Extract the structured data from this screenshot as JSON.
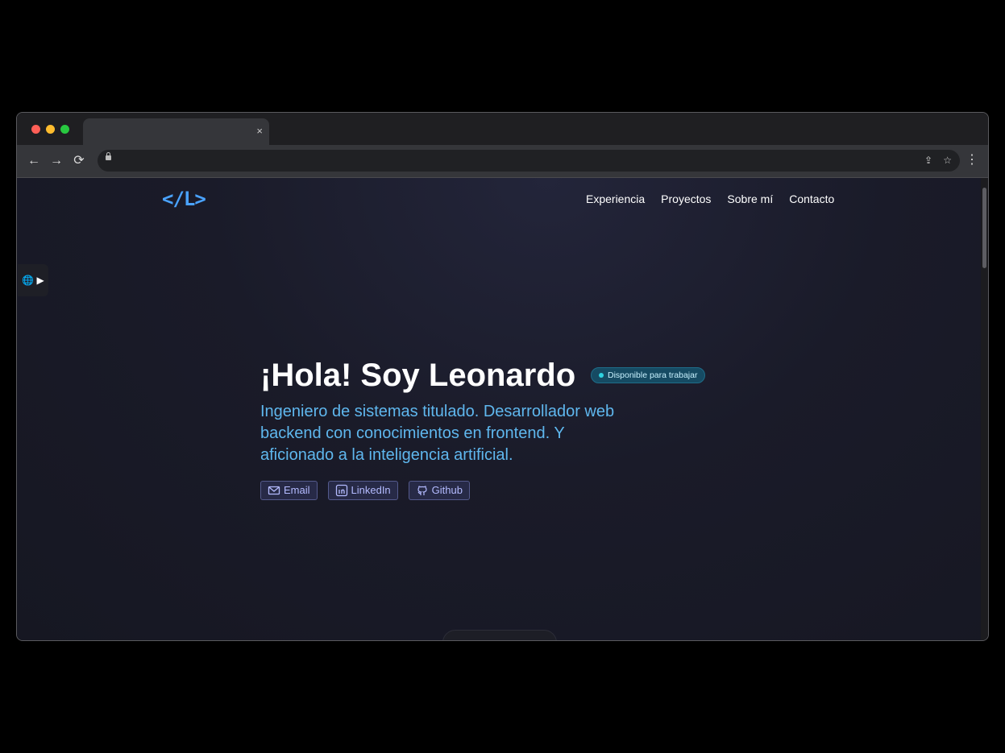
{
  "browser": {
    "tab_close": "×",
    "back_icon": "←",
    "forward_icon": "→",
    "reload_icon": "⟳",
    "share_icon": "⇪",
    "star_icon": "☆",
    "menu_icon": "⋮"
  },
  "site": {
    "logo": "</L>",
    "nav": [
      "Experiencia",
      "Proyectos",
      "Sobre mí",
      "Contacto"
    ],
    "language_toggle": "🌐 ▶",
    "hero": {
      "title": "¡Hola! Soy Leonardo",
      "badge": "Disponible para trabajar",
      "subtitle": "Ingeniero de sistemas titulado. Desarrollador web backend con conocimientos en frontend. Y aficionado a la inteligencia artificial."
    },
    "buttons": [
      {
        "label": "Email",
        "icon": "mail-icon"
      },
      {
        "label": "LinkedIn",
        "icon": "linkedin-icon"
      },
      {
        "label": "Github",
        "icon": "github-icon"
      }
    ]
  },
  "colors": {
    "accent": "#4aa3ff",
    "subtitle": "#5fb7ee",
    "badge_bg": "#164b63",
    "button_bg": "#272a47"
  }
}
